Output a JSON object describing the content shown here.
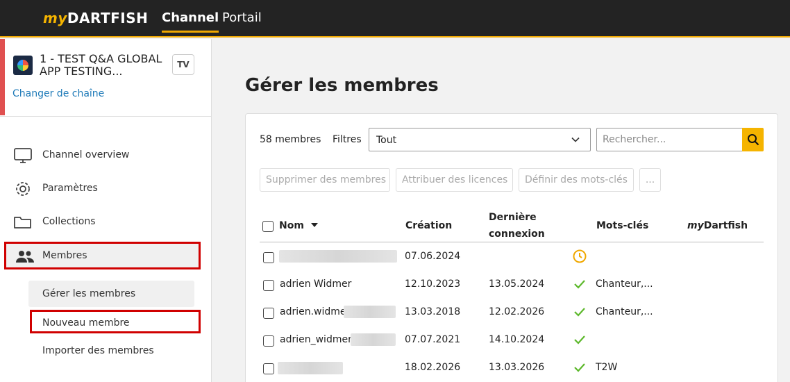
{
  "topbar": {
    "logo_my": "my",
    "logo_rest": "DARTFISH",
    "tabs": [
      {
        "label": "Channel",
        "active": true
      },
      {
        "label": "Portail",
        "active": false
      }
    ],
    "accent_color": "#f0a800"
  },
  "sidebar": {
    "channel": {
      "name": "1 - TEST Q&A GLOBAL APP TESTING...",
      "badge": "TV",
      "change_link": "Changer de chaîne"
    },
    "menu": [
      {
        "label": "Channel overview",
        "icon": "monitor-icon"
      },
      {
        "label": "Paramètres",
        "icon": "gear-icon"
      },
      {
        "label": "Collections",
        "icon": "folder-icon"
      },
      {
        "label": "Membres",
        "icon": "users-icon",
        "active": true
      }
    ],
    "submenu": [
      {
        "label": "Gérer les membres",
        "active": true
      },
      {
        "label": "Nouveau membre"
      },
      {
        "label": "Importer des membres"
      }
    ]
  },
  "main": {
    "title": "Gérer les membres",
    "count_label": "58  membres",
    "filters_label": "Filtres",
    "filter_value": "Tout",
    "search_placeholder": "Rechercher...",
    "actions": {
      "delete": "Supprimer des membres",
      "licenses": "Attribuer des licences",
      "keywords": "Définir des mots-clés",
      "more": "..."
    },
    "columns": {
      "name": "Nom",
      "created": "Création",
      "last_login_1": "Dernière",
      "last_login_2": "connexion",
      "keywords": "Mots-clés",
      "mydartfish_my": "my",
      "mydartfish_rest": "Dartfish"
    },
    "rows": [
      {
        "name": "",
        "created": "07.06.2024",
        "last_login": "",
        "status": "pending",
        "keywords": ""
      },
      {
        "name": "adrien Widmer",
        "created": "12.10.2023",
        "last_login": "13.05.2024",
        "status": "active",
        "keywords": "Chanteur,..."
      },
      {
        "name": "adrien.widme",
        "created": "13.03.2018",
        "last_login": "12.02.2026",
        "status": "active",
        "keywords": "Chanteur,..."
      },
      {
        "name": "adrien_widmer",
        "created": "07.07.2021",
        "last_login": "14.10.2024",
        "status": "active",
        "keywords": ""
      },
      {
        "name": "",
        "created": "18.02.2026",
        "last_login": "13.03.2026",
        "status": "active",
        "keywords": "T2W"
      }
    ]
  }
}
